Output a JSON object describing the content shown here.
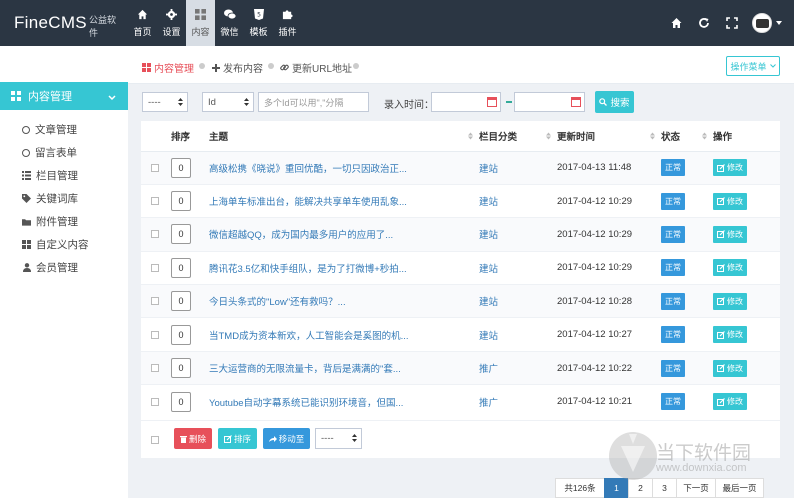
{
  "header": {
    "brand": "FineCMS",
    "brand_sub": "公益软件",
    "nav": [
      {
        "label": "首页",
        "icon": "home-icon"
      },
      {
        "label": "设置",
        "icon": "gear-icon"
      },
      {
        "label": "内容",
        "icon": "grid-icon",
        "active": true
      },
      {
        "label": "微信",
        "icon": "wechat-icon"
      },
      {
        "label": "模板",
        "icon": "html5-icon"
      },
      {
        "label": "插件",
        "icon": "puzzle-icon"
      }
    ]
  },
  "sidebar": {
    "section": "内容管理",
    "items": [
      {
        "label": "文章管理",
        "icon": "circle-icon"
      },
      {
        "label": "留言表单",
        "icon": "circle-icon"
      },
      {
        "label": "栏目管理",
        "icon": "list-icon"
      },
      {
        "label": "关键词库",
        "icon": "tag-icon"
      },
      {
        "label": "附件管理",
        "icon": "folder-icon"
      },
      {
        "label": "自定义内容",
        "icon": "grid-icon"
      },
      {
        "label": "会员管理",
        "icon": "user-icon"
      }
    ]
  },
  "breadcrumb": {
    "items": [
      {
        "label": "内容管理",
        "active": true
      },
      {
        "label": "发布内容"
      },
      {
        "label": "更新URL地址"
      }
    ],
    "menu_button": "操作菜单"
  },
  "filters": {
    "select1": "----",
    "select2": "Id",
    "keyword_placeholder": "多个Id可以用\",\"分隔",
    "time_label": "录入时间：",
    "search_label": "搜索"
  },
  "table": {
    "columns": [
      "排序",
      "主题",
      "栏目分类",
      "更新时间",
      "状态",
      "操作"
    ],
    "rows": [
      {
        "sort": "0",
        "title": "高级松携《晓说》重回优酷，一切只因政治正...",
        "category": "建站",
        "time": "2017-04-13 11:48",
        "status": "正常",
        "action": "修改"
      },
      {
        "sort": "0",
        "title": "上海单车标准出台，能解决共享单车使用乱象...",
        "category": "建站",
        "time": "2017-04-12 10:29",
        "status": "正常",
        "action": "修改"
      },
      {
        "sort": "0",
        "title": "微信超越QQ，成为国内最多用户的应用了...",
        "category": "建站",
        "time": "2017-04-12 10:29",
        "status": "正常",
        "action": "修改"
      },
      {
        "sort": "0",
        "title": "腾讯花3.5亿和快手组队，是为了打微博+秒拍...",
        "category": "建站",
        "time": "2017-04-12 10:29",
        "status": "正常",
        "action": "修改"
      },
      {
        "sort": "0",
        "title": "今日头条式的\"Low\"还有救吗？...",
        "category": "建站",
        "time": "2017-04-12 10:28",
        "status": "正常",
        "action": "修改"
      },
      {
        "sort": "0",
        "title": "当TMD成为资本新欢，人工智能会是奚图的机...",
        "category": "建站",
        "time": "2017-04-12 10:27",
        "status": "正常",
        "action": "修改"
      },
      {
        "sort": "0",
        "title": "三大运营商的无限流量卡，背后是满满的\"套...",
        "category": "推广",
        "time": "2017-04-12 10:22",
        "status": "正常",
        "action": "修改"
      },
      {
        "sort": "0",
        "title": "Youtube自动字幕系统已能识别环境音，但国...",
        "category": "推广",
        "time": "2017-04-12 10:21",
        "status": "正常",
        "action": "修改"
      }
    ],
    "bulk": {
      "delete": "删除",
      "sort": "排序",
      "move": "移动至",
      "move_select": "----"
    }
  },
  "pagination": {
    "total": "共126条",
    "pages": [
      "1",
      "2",
      "3"
    ],
    "current": "1",
    "next": "下一页",
    "last": "最后一页"
  },
  "watermark": {
    "text": "当下软件园",
    "url": "www.downxia.com"
  },
  "colors": {
    "topbar": "#2b3643",
    "accent": "#36c6d3",
    "link": "#337ab7",
    "badge": "#3598dc",
    "danger": "#e7505a"
  }
}
